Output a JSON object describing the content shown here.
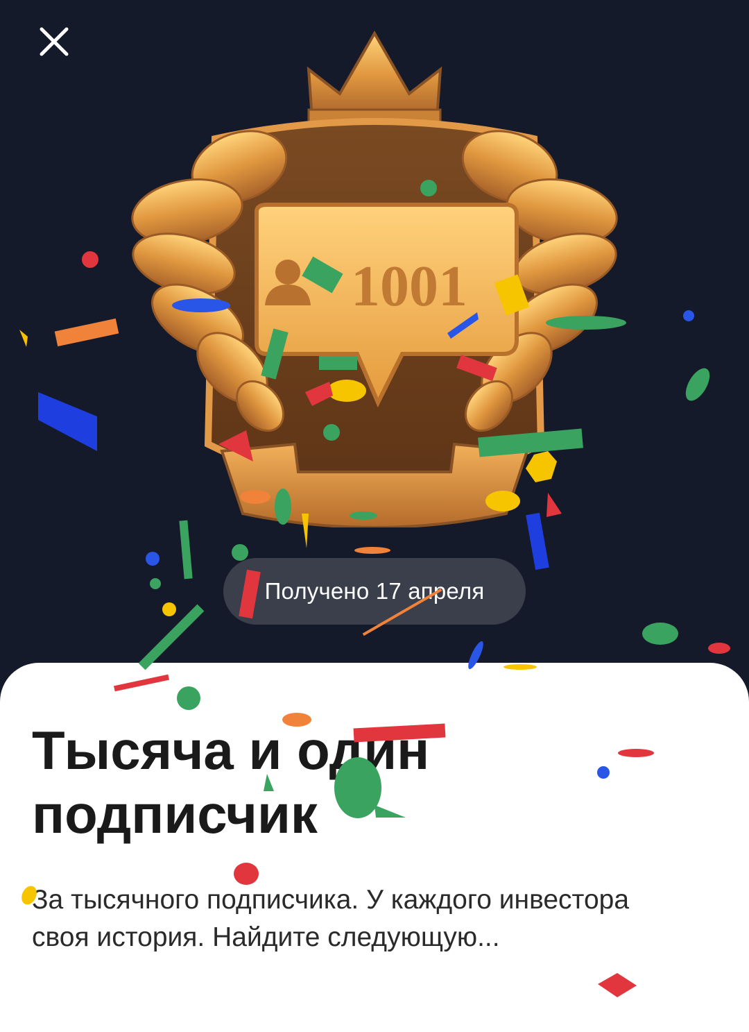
{
  "header": {
    "close_icon": "close-icon"
  },
  "badge": {
    "icon": "subscriber-badge-icon",
    "count": "1001",
    "colors": {
      "gold": "#e3a24a",
      "gold_light": "#ffcf6e",
      "bronze": "#8a5326"
    }
  },
  "earned": {
    "text": "Получено 17 апреля"
  },
  "achievement": {
    "title": "Тысяча и один подписчик",
    "description": "За тысячного подписчика. У каждого инвестора своя история. Найдите следующую..."
  },
  "colors": {
    "background": "#141a2a",
    "sheet": "#ffffff",
    "pill": "#3a3f4b"
  }
}
